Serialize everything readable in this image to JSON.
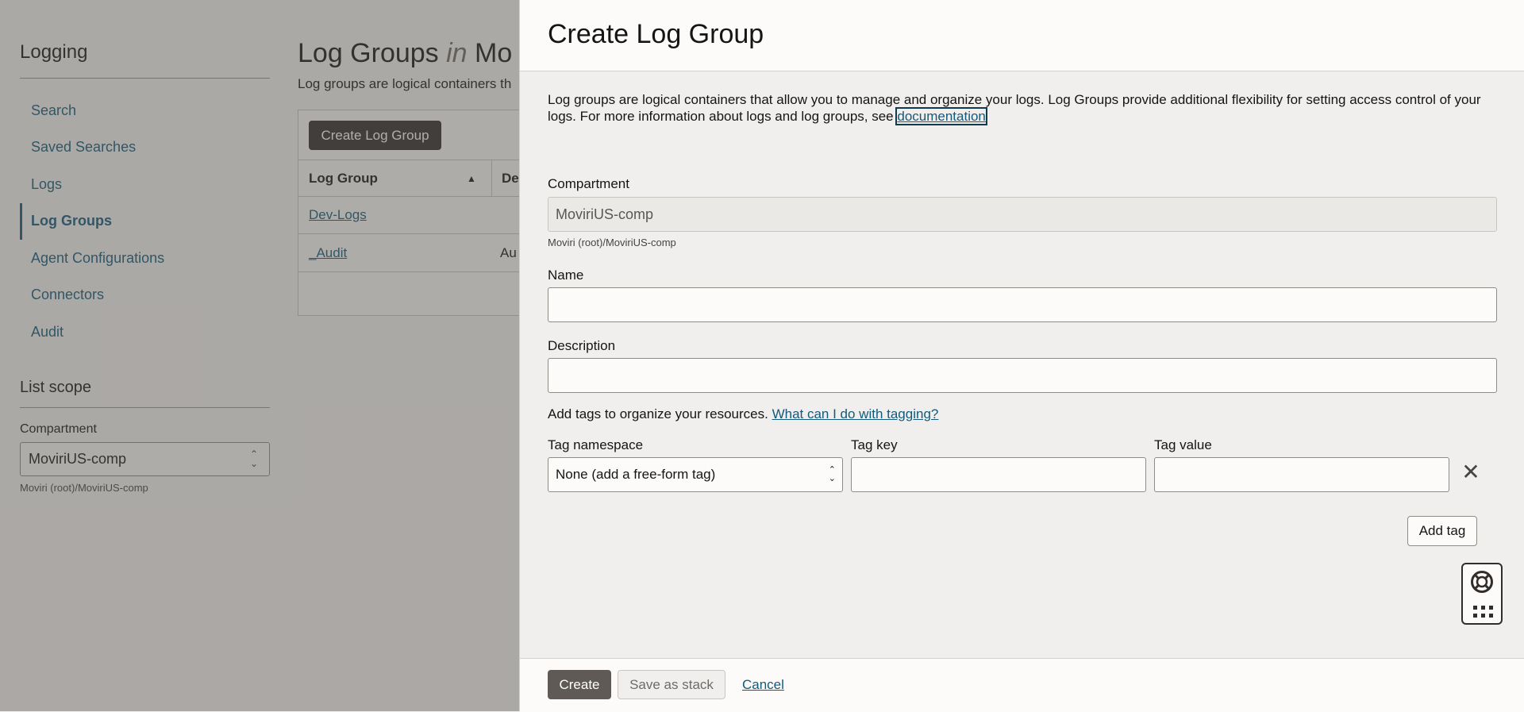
{
  "sidebar": {
    "title": "Logging",
    "items": [
      {
        "label": "Search"
      },
      {
        "label": "Saved Searches"
      },
      {
        "label": "Logs"
      },
      {
        "label": "Log Groups"
      },
      {
        "label": "Agent Configurations"
      },
      {
        "label": "Connectors"
      },
      {
        "label": "Audit"
      }
    ],
    "active_item": "Log Groups",
    "scope": {
      "title": "List scope",
      "compartment_label": "Compartment",
      "compartment_value": "MoviriUS-comp",
      "compartment_path": "Moviri (root)/MoviriUS-comp"
    }
  },
  "main": {
    "title_prefix": "Log Groups ",
    "title_in": "in",
    "title_suffix": " Mo",
    "subtitle": "Log groups are logical containers th",
    "create_button": "Create Log Group",
    "table": {
      "columns": [
        "Log Group",
        "De"
      ],
      "rows": [
        {
          "name": "Dev-Logs",
          "col2": ""
        },
        {
          "name": "_Audit",
          "col2": "Au"
        }
      ]
    }
  },
  "panel": {
    "title": "Create Log Group",
    "intro_text": "Log groups are logical containers that allow you to manage and organize your logs. Log Groups provide additional flexibility for setting access control of your logs. For more information about logs and log groups, see ",
    "intro_link": "documentation",
    "compartment": {
      "label": "Compartment",
      "value": "MoviriUS-comp",
      "help": "Moviri (root)/MoviriUS-comp"
    },
    "name": {
      "label": "Name",
      "value": ""
    },
    "description": {
      "label": "Description",
      "value": ""
    },
    "tags": {
      "text": "Add tags to organize your resources.",
      "link": "What can I do with tagging?",
      "namespace_label": "Tag namespace",
      "namespace_value": "None (add a free-form tag)",
      "key_label": "Tag key",
      "key_value": "",
      "value_label": "Tag value",
      "value_value": "",
      "add_button": "Add tag"
    },
    "footer": {
      "create": "Create",
      "save_stack": "Save as stack",
      "cancel": "Cancel"
    }
  },
  "icons": {
    "sort": "sort-ascending-icon",
    "remove": "close-icon",
    "help": "lifebuoy-icon",
    "apps": "grid-icon"
  }
}
